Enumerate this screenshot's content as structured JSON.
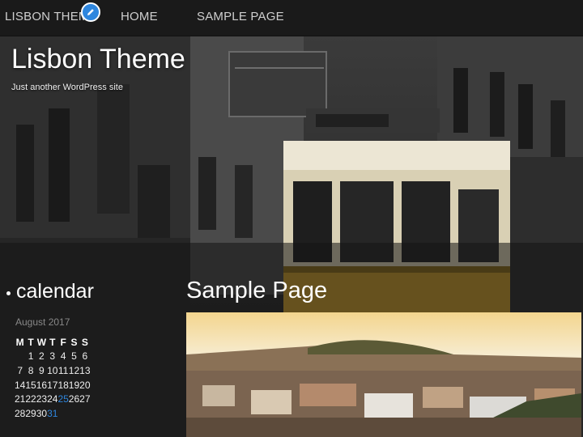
{
  "nav": {
    "site_name": "LISBON THEME",
    "items": [
      {
        "label": "HOME"
      },
      {
        "label": "SAMPLE PAGE"
      }
    ],
    "edit_icon": "pencil-icon"
  },
  "header": {
    "title": "Lisbon Theme",
    "tagline": "Just another WordPress site",
    "background_image": "Lisbon street with yellow tram"
  },
  "sidebar": {
    "widget_title": "calendar",
    "calendar": {
      "caption": "August 2017",
      "weekdays": [
        "M",
        "T",
        "W",
        "T",
        "F",
        "S",
        "S"
      ],
      "weeks": [
        [
          "",
          "1",
          "2",
          "3",
          "4",
          "5",
          "6"
        ],
        [
          "7",
          "8",
          "9",
          "10",
          "11",
          "12",
          "13"
        ],
        [
          "14",
          "15",
          "16",
          "17",
          "18",
          "19",
          "20"
        ],
        [
          "21",
          "22",
          "23",
          "24",
          "25",
          "26",
          "27"
        ],
        [
          "28",
          "29",
          "30",
          "31",
          "",
          "",
          ""
        ]
      ],
      "linked_days": [
        "25",
        "31"
      ]
    }
  },
  "main": {
    "page_title": "Sample Page",
    "featured_image": "Lisbon cityscape at sunset"
  },
  "colors": {
    "accent": "#2e86de",
    "nav_bg": "#1a1a1a",
    "text": "#ffffff"
  }
}
